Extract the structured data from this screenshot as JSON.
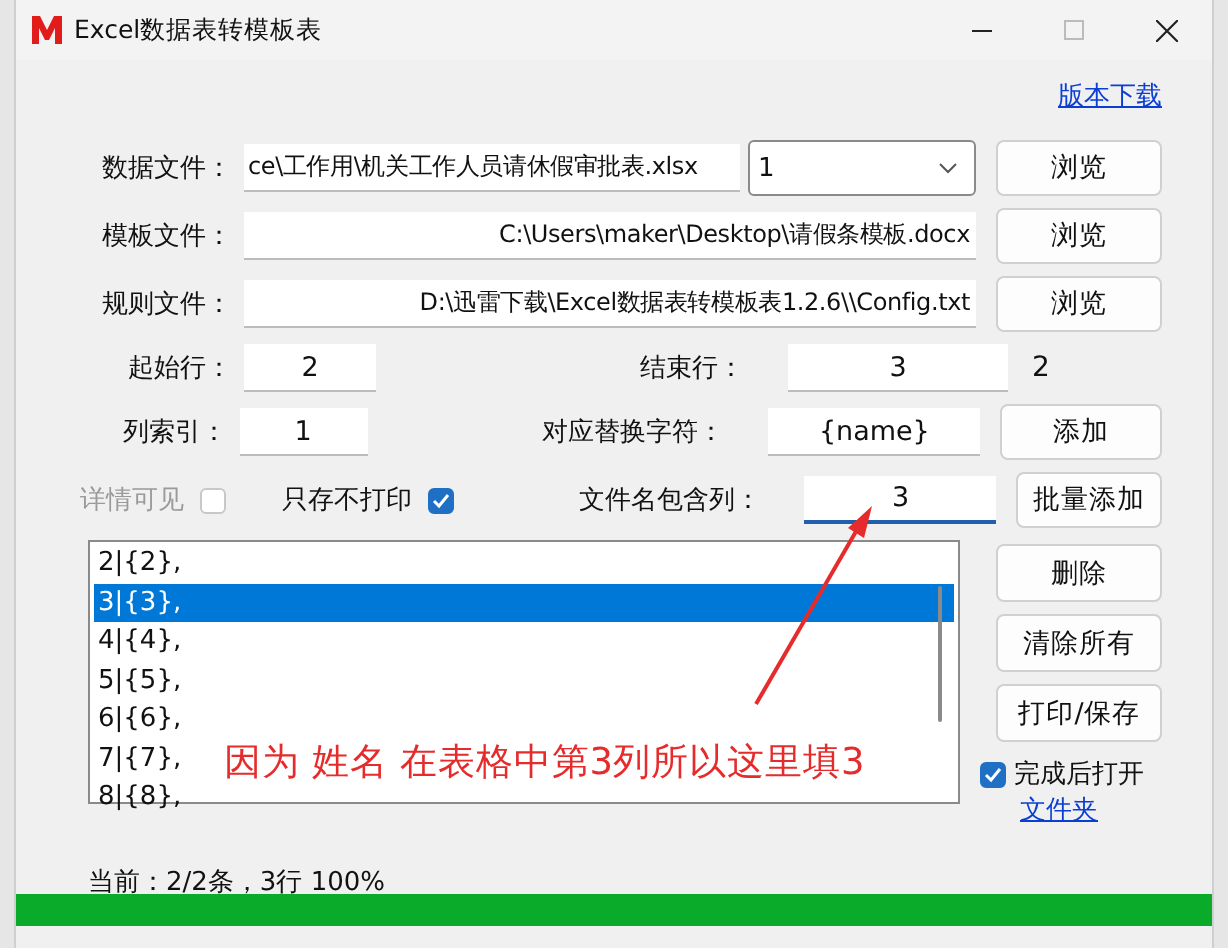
{
  "window": {
    "title": "Excel数据表转模板表"
  },
  "version_link": "版本下载",
  "file_rows": [
    {
      "label": "数据文件：",
      "value": "ce\\工作用\\机关工作人员请休假审批表.xlsx",
      "sheet": "1",
      "button": "浏览"
    },
    {
      "label": "模板文件：",
      "value": "C:\\Users\\maker\\Desktop\\请假条模板.docx",
      "button": "浏览"
    },
    {
      "label": "规则文件：",
      "value": "D:\\迅雷下载\\Excel数据表转模板表1.2.6\\\\Config.txt",
      "button": "浏览"
    }
  ],
  "start_row": {
    "label": "起始行：",
    "value": "2"
  },
  "end_row": {
    "label": "结束行：",
    "value": "3",
    "note": "2"
  },
  "column_index": {
    "label": "列索引：",
    "value": "1"
  },
  "replace_char": {
    "label": "对应替换字符：",
    "value": "{name}",
    "button": "添加"
  },
  "detail_visible": {
    "label": "详情可见",
    "checked": false,
    "disabled": true
  },
  "save_only": {
    "label": "只存不打印",
    "checked": true,
    "disabled": false
  },
  "filename_column": {
    "label": "文件名包含列：",
    "value": "3",
    "focused": true,
    "button": "批量添加"
  },
  "list_items": [
    {
      "text": "2|{2},",
      "selected": false
    },
    {
      "text": "3|{3},",
      "selected": true
    },
    {
      "text": "4|{4},",
      "selected": false
    },
    {
      "text": "5|{5},",
      "selected": false
    },
    {
      "text": "6|{6},",
      "selected": false
    },
    {
      "text": "7|{7},",
      "selected": false
    },
    {
      "text": "8|{8},",
      "selected": false
    }
  ],
  "side_buttons": [
    "删除",
    "清除所有",
    "打印/保存"
  ],
  "open_after": {
    "label": "完成后打开",
    "checked": true,
    "link": "文件夹"
  },
  "status": "当前：2/2条，3行 100%",
  "progress": {
    "level": 1
  },
  "annotation": "因为 姓名 在表格中第3列所以这里填3"
}
